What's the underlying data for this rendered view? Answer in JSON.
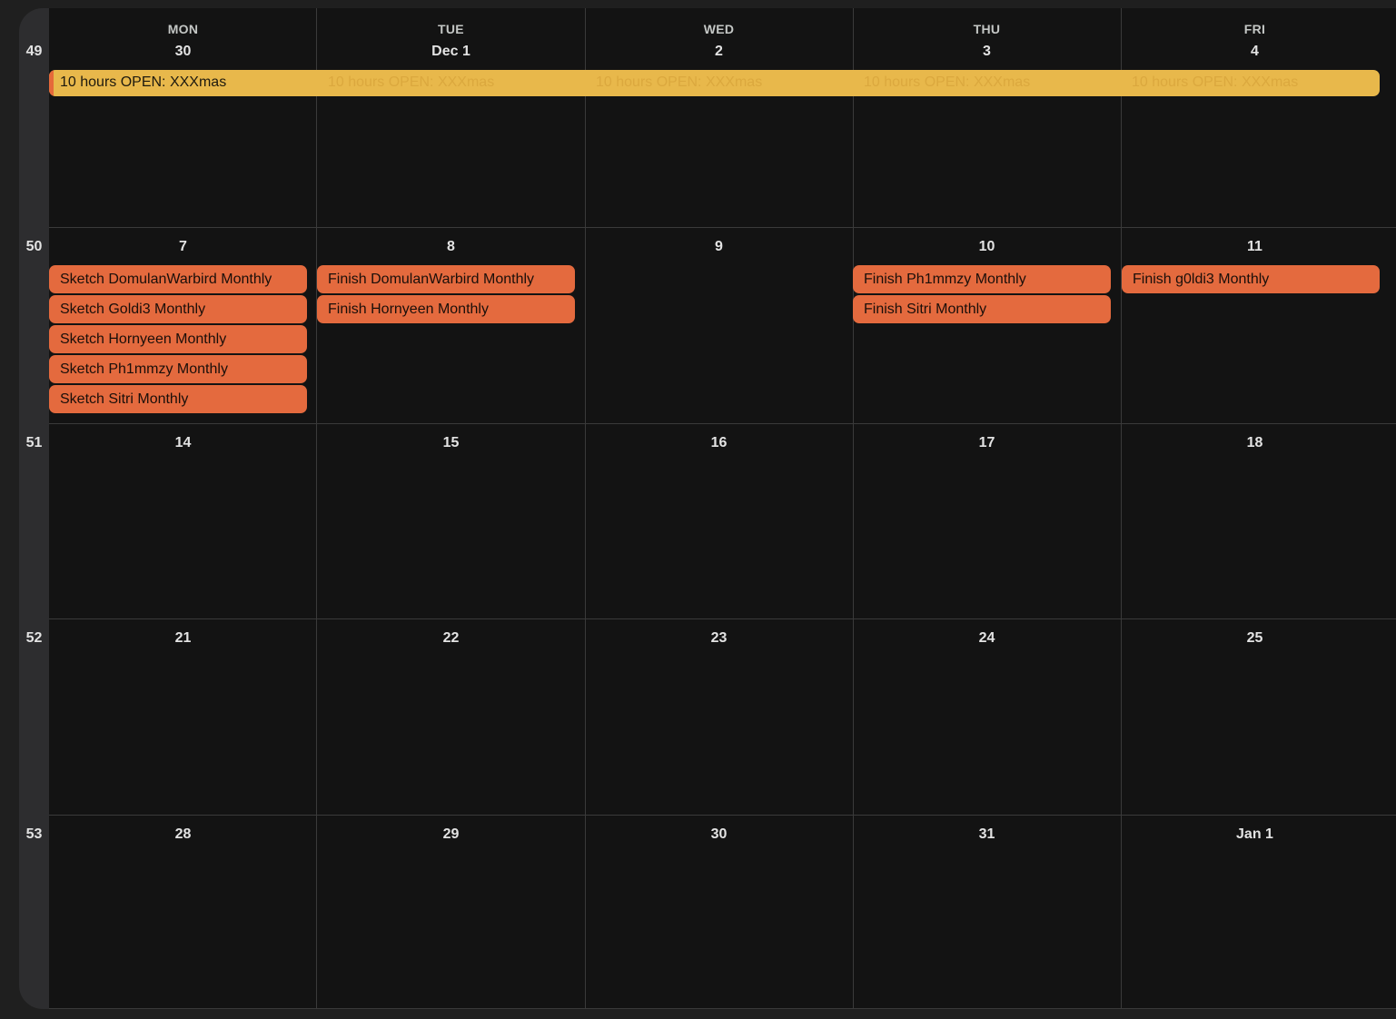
{
  "days_of_week": [
    "MON",
    "TUE",
    "WED",
    "THU",
    "FRI"
  ],
  "weeks": [
    {
      "number": "49",
      "dates": [
        "30",
        "Dec 1",
        "2",
        "3",
        "4"
      ]
    },
    {
      "number": "50",
      "dates": [
        "7",
        "8",
        "9",
        "10",
        "11"
      ]
    },
    {
      "number": "51",
      "dates": [
        "14",
        "15",
        "16",
        "17",
        "18"
      ]
    },
    {
      "number": "52",
      "dates": [
        "21",
        "22",
        "23",
        "24",
        "25"
      ]
    },
    {
      "number": "53",
      "dates": [
        "28",
        "29",
        "30",
        "31",
        "Jan 1"
      ]
    }
  ],
  "multi_day_event": {
    "title": "10 hours OPEN: XXXmas",
    "color": "#e8b84b",
    "edge_color": "#e5693a"
  },
  "events": {
    "mon_7": [
      "Sketch DomulanWarbird Monthly",
      "Sketch Goldi3 Monthly",
      "Sketch Hornyeen Monthly",
      "Sketch Ph1mmzy Monthly",
      "Sketch Sitri Monthly"
    ],
    "tue_8": [
      "Finish DomulanWarbird Monthly",
      "Finish Hornyeen Monthly"
    ],
    "thu_10": [
      "Finish Ph1mmzy Monthly",
      "Finish Sitri Monthly"
    ],
    "fri_11": [
      "Finish g0ldi3 Monthly"
    ]
  },
  "colors": {
    "event": "#e46a3e",
    "background": "#131313",
    "gutter": "#2d2d2f"
  }
}
